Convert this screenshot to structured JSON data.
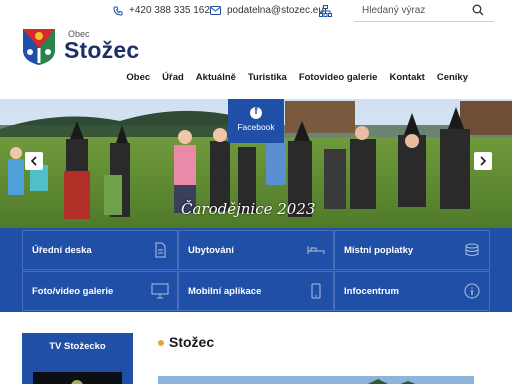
{
  "header": {
    "phone": "+420 388 335 162",
    "email": "podatelna@stozec.eu",
    "sitemap_icon": "sitemap-icon",
    "search": {
      "placeholder": "Hledaný výraz",
      "icon": "search-icon"
    }
  },
  "logo": {
    "obec_label": "Obec",
    "name": "Stožec",
    "crest_icon": "crest-icon"
  },
  "nav": {
    "items": [
      {
        "label": "Obec"
      },
      {
        "label": "Úřad"
      },
      {
        "label": "Aktuálně"
      },
      {
        "label": "Turistika"
      },
      {
        "label": "Fotovideo galerie"
      },
      {
        "label": "Kontakt"
      },
      {
        "label": "Ceníky"
      }
    ]
  },
  "hero": {
    "facebook_label": "Facebook",
    "caption": "Čarodějnice 2023",
    "prev_icon": "chevron-left-icon",
    "next_icon": "chevron-right-icon"
  },
  "tiles": [
    {
      "label": "Úřední deska",
      "icon": "document-icon"
    },
    {
      "label": "Ubytování",
      "icon": "bed-icon"
    },
    {
      "label": "Místní poplatky",
      "icon": "coins-icon"
    },
    {
      "label": "Foto/video galerie",
      "icon": "monitor-icon"
    },
    {
      "label": "Mobilní aplikace",
      "icon": "phone-icon"
    },
    {
      "label": "Infocentrum",
      "icon": "info-icon"
    }
  ],
  "sidebar": {
    "tv_title": "TV Stožecko"
  },
  "main": {
    "section_title": "Stožec"
  },
  "colors": {
    "primary": "#1f4fa6",
    "dark_navy": "#1c2f6b",
    "accent": "#e8a33d"
  }
}
